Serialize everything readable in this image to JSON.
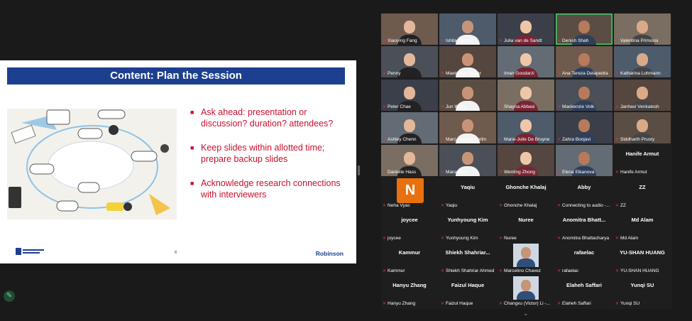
{
  "slide": {
    "title": "Content: Plan the Session",
    "bullets": [
      "Ask ahead: presentation or discussion? duration? attendees?",
      "Keep slides within allotted time; prepare backup slides",
      "Acknowledge research connections with interviewers"
    ],
    "bullet_color": "#c8102e",
    "title_bar_color": "#1d3f8f",
    "page_number": "6",
    "brand": "Robinson",
    "footer_logo_text": "Georgia State University · ROBINSON COLLEGE OF BUSINESS",
    "image_words": [
      "PLAN",
      "CONCEPT",
      "IDEAS",
      "VISION",
      "THINK",
      "GOOD",
      "CREATE",
      "Yes!",
      "BIG IDEA"
    ]
  },
  "participants": [
    {
      "name": "Xiaoying Fang",
      "video": true
    },
    {
      "name": "Ishita Nagpal",
      "video": true
    },
    {
      "name": "Julia van de Sandt",
      "video": true
    },
    {
      "name": "Denish Shah",
      "video": true,
      "active": true
    },
    {
      "name": "Valentina Primossi",
      "video": true
    },
    {
      "name": "Penny",
      "video": true
    },
    {
      "name": "Maximilian Bauer",
      "video": true
    },
    {
      "name": "Iman Goodarzi",
      "video": true
    },
    {
      "name": "Ana Tereza Delapedra",
      "video": true
    },
    {
      "name": "Katharina Lohmann",
      "video": true
    },
    {
      "name": "Peter Chae",
      "video": true
    },
    {
      "name": "Jun Wang",
      "video": true
    },
    {
      "name": "Shayna Abbasi",
      "video": true
    },
    {
      "name": "Mackenzie Volk",
      "video": true
    },
    {
      "name": "Janhavi Venkatesh",
      "video": true
    },
    {
      "name": "Ashley Chenn",
      "video": true
    },
    {
      "name": "Marc-Antoine Fortin",
      "video": true
    },
    {
      "name": "Marie-Julie De Bruyne",
      "video": true
    },
    {
      "name": "Zahra Boojavi",
      "video": true
    },
    {
      "name": "Siddharth Prusty",
      "video": true
    },
    {
      "name": "Danielle Hass",
      "video": true
    },
    {
      "name": "Manaswini",
      "video": true
    },
    {
      "name": "Wenting Zhong",
      "video": true
    },
    {
      "name": "Elena Elkanova",
      "video": true
    },
    {
      "name": "Hanife Armut",
      "display": "Hanife Armut"
    },
    {
      "name": "Neha Vyas",
      "avatar_letter": "N"
    },
    {
      "name": "Yaqiu",
      "display": "Yaqiu"
    },
    {
      "name": "Ghonche Khalaj",
      "display": "Ghonche Khalaj"
    },
    {
      "name": "Connecting to audio -...",
      "display": "Abby"
    },
    {
      "name": "ZZ",
      "display": "ZZ"
    },
    {
      "name": "joycee",
      "display": "joycee"
    },
    {
      "name": "Yunhyoung Kim",
      "display": "Yunhyoung Kim"
    },
    {
      "name": "Nuree",
      "display": "Nuree"
    },
    {
      "name": "Anomitra Bhattacharya",
      "display": "Anomitra Bhatt..."
    },
    {
      "name": "Md Alam",
      "display": "Md Alam"
    },
    {
      "name": "Kammur",
      "display": "Kammur"
    },
    {
      "name": "Shiekh Shahriar Ahmed",
      "display": "Shiekh Shahriar..."
    },
    {
      "name": "Marcelino Chavez",
      "photo": true
    },
    {
      "name": "rafaelac",
      "display": "rafaelac"
    },
    {
      "name": "YU-SHAN HUANG",
      "display": "YU-SHAN HUANG"
    },
    {
      "name": "Hanyu Zhang",
      "display": "Hanyu Zhang"
    },
    {
      "name": "Faizul Haque",
      "display": "Faizul Haque"
    },
    {
      "name": "Changxu (Victor) Li -...",
      "photo": true
    },
    {
      "name": "Elaheh Saffari",
      "display": "Elaheh Saffari"
    },
    {
      "name": "Yunqi SU",
      "display": "Yunqi SU"
    }
  ],
  "scroll_indicator": "chevron-down"
}
